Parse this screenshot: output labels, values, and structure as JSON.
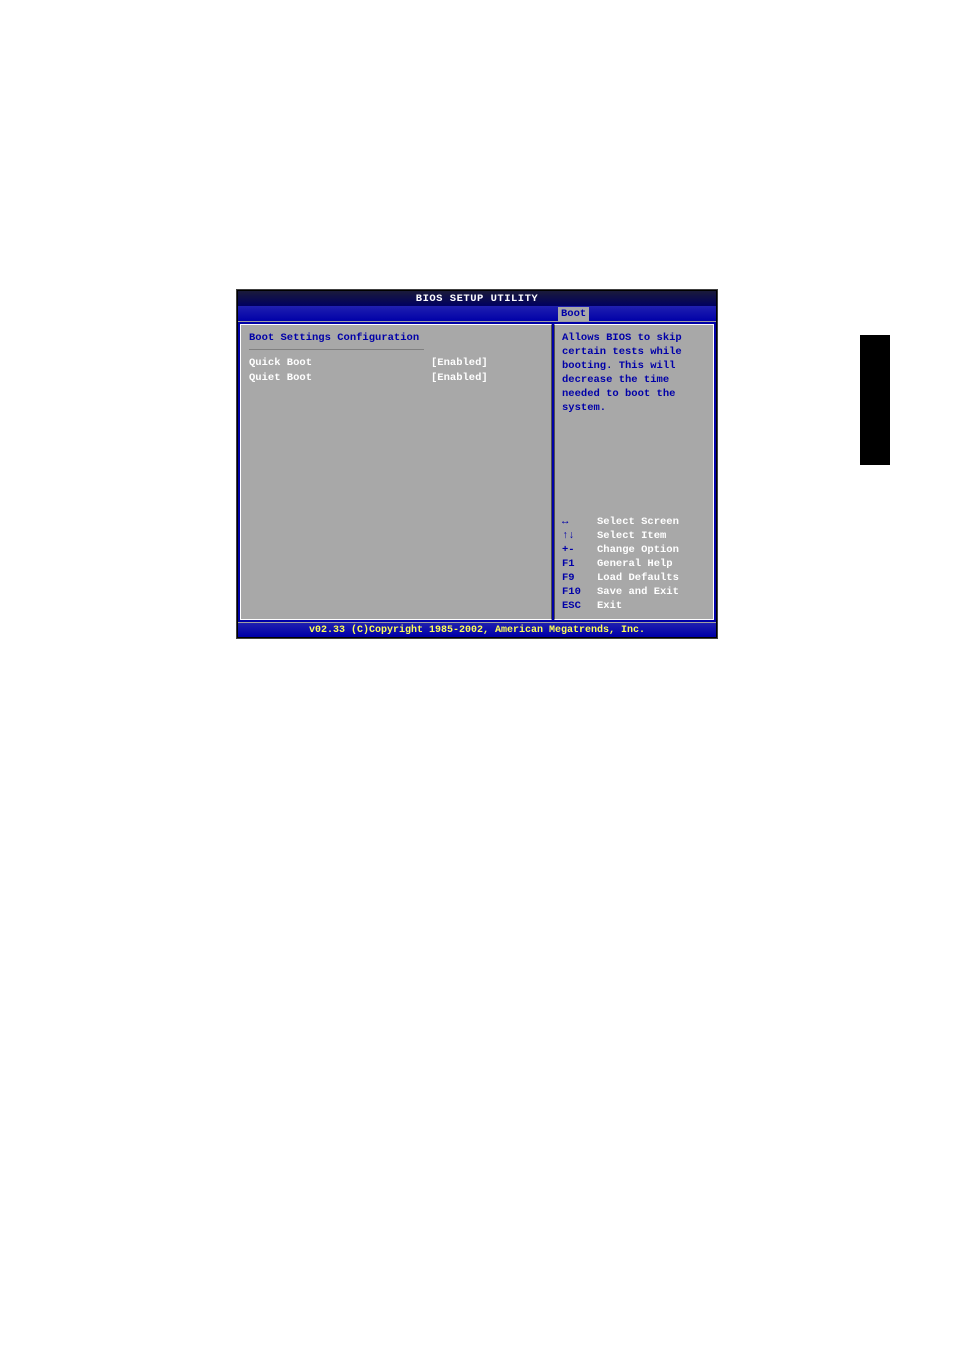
{
  "title": "BIOS SETUP UTILITY",
  "menu": {
    "active_tab": "Boot"
  },
  "main": {
    "section_title": "Boot Settings Configuration",
    "settings": [
      {
        "label": "Quick Boot",
        "value": "[Enabled]"
      },
      {
        "label": "Quiet Boot",
        "value": "[Enabled]"
      }
    ]
  },
  "help": {
    "text": "Allows BIOS to skip certain tests while booting. This will decrease the time needed to boot the system."
  },
  "keys": [
    {
      "k": "↔",
      "d": "Select Screen"
    },
    {
      "k": "↑↓",
      "d": "Select Item"
    },
    {
      "k": "+-",
      "d": "Change Option"
    },
    {
      "k": "F1",
      "d": "General Help"
    },
    {
      "k": "F9",
      "d": "Load Defaults"
    },
    {
      "k": "F10",
      "d": "Save and Exit"
    },
    {
      "k": "ESC",
      "d": "Exit"
    }
  ],
  "footer": "v02.33 (C)Copyright 1985-2002, American Megatrends, Inc."
}
